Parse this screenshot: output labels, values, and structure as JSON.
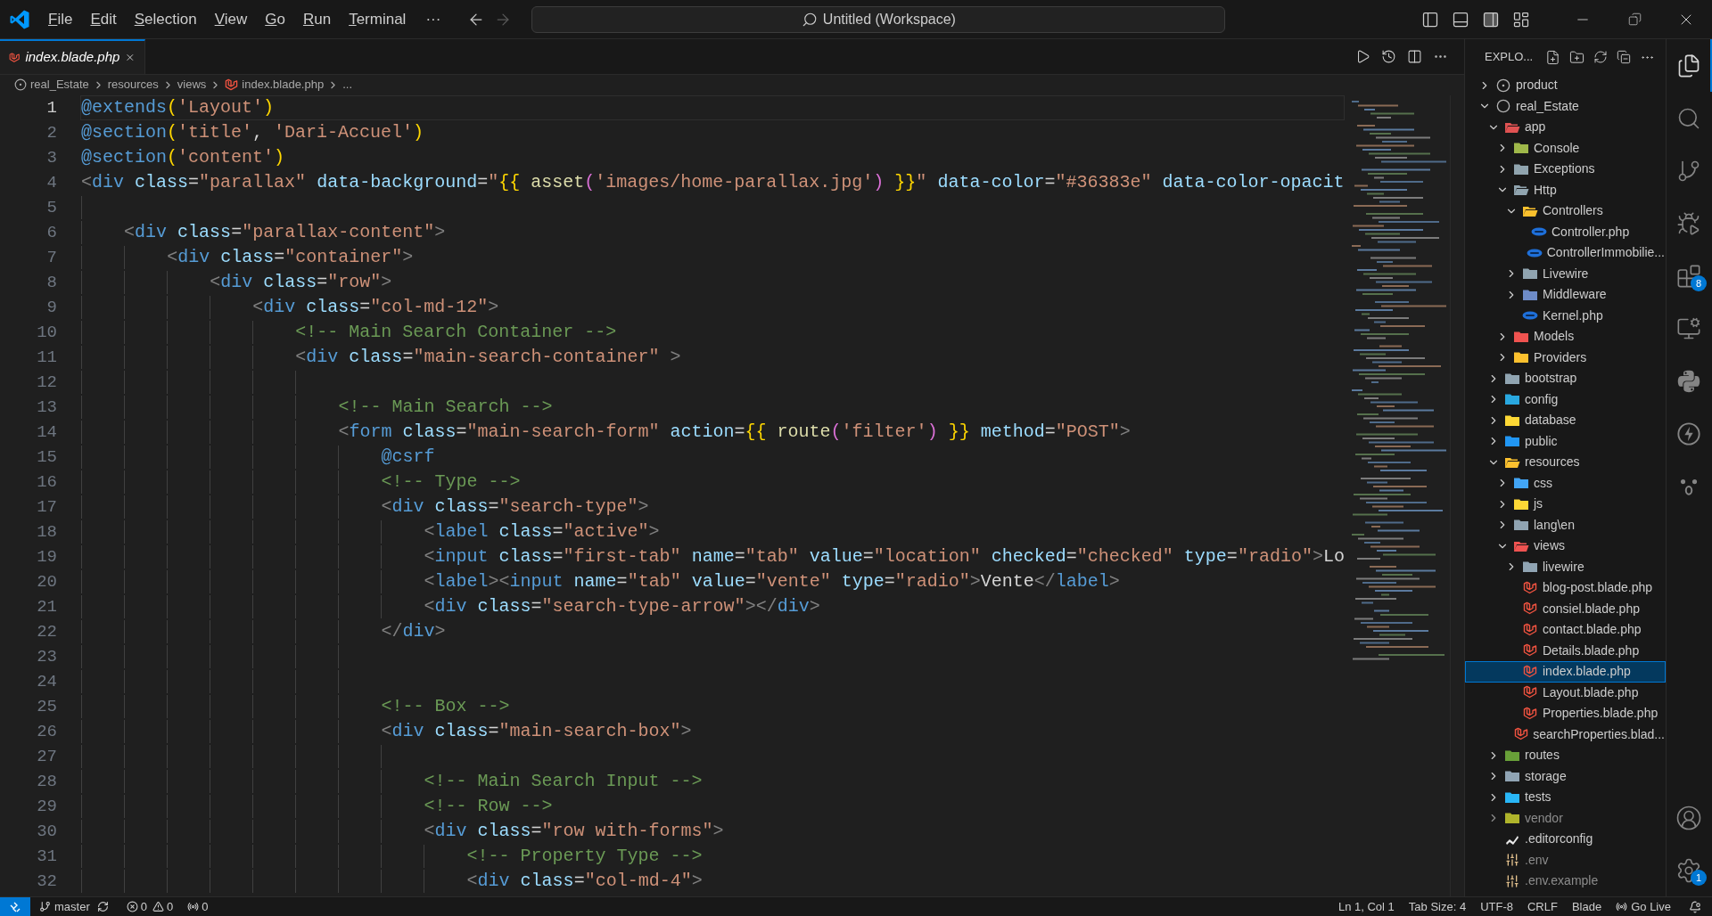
{
  "title_bar": {
    "menu": [
      "File",
      "Edit",
      "Selection",
      "View",
      "Go",
      "Run",
      "Terminal"
    ],
    "more": "···",
    "nav": [
      {
        "kind": "back",
        "disabled": false
      },
      {
        "kind": "forward",
        "disabled": true
      }
    ],
    "search": "Untitled (Workspace)"
  },
  "tabs": [
    {
      "label": "index.blade.php",
      "preview": true,
      "selected": true
    }
  ],
  "breadcrumb": [
    {
      "label": "real_Estate",
      "kind": "root"
    },
    {
      "label": "resources",
      "kind": "folder"
    },
    {
      "label": "views",
      "kind": "folder"
    },
    {
      "label": "index.blade.php",
      "kind": "blade"
    },
    {
      "label": "...",
      "kind": "more"
    }
  ],
  "editor": {
    "lines": [
      {
        "n": "1",
        "text": "@extends('Layout')",
        "current": true
      },
      {
        "n": "2",
        "text": "@section('title', 'Dari-Accuel')",
        "current": false
      },
      {
        "n": "3",
        "text": "@section('content')",
        "current": false
      },
      {
        "n": "4",
        "text": "<div class=\"parallax\" data-background=\"{{ asset('images/home-parallax.jpg') }}\" data-color=\"#36383e\" data-color-opacit",
        "current": false
      },
      {
        "n": "5",
        "current": false
      },
      {
        "n": "6",
        "text": "    <div class=\"parallax-content\">",
        "current": false
      },
      {
        "n": "7",
        "text": "        <div class=\"container\">",
        "current": false
      },
      {
        "n": "8",
        "text": "            <div class=\"row\">",
        "current": false
      },
      {
        "n": "9",
        "text": "                <div class=\"col-md-12\">",
        "current": false
      },
      {
        "n": "10",
        "text": "                    <!-- Main Search Container -->",
        "current": false
      },
      {
        "n": "11",
        "text": "                    <div class=\"main-search-container\" >",
        "current": false
      },
      {
        "n": "12",
        "current": false
      },
      {
        "n": "13",
        "text": "                        <!-- Main Search -->",
        "current": false
      },
      {
        "n": "14",
        "text": "                        <form class=\"main-search-form\" action={{ route('filter') }} method=\"POST\">",
        "current": false
      },
      {
        "n": "15",
        "text": "                            @csrf",
        "current": false
      },
      {
        "n": "16",
        "text": "                            <!-- Type -->",
        "current": false
      },
      {
        "n": "17",
        "text": "                            <div class=\"search-type\">",
        "current": false
      },
      {
        "n": "18",
        "text": "                                <label class=\"active\">",
        "current": false
      },
      {
        "n": "19",
        "text": "                                <input class=\"first-tab\" name=\"tab\" value=\"location\" checked=\"checked\" type=\"radio\">Lo",
        "current": false
      },
      {
        "n": "20",
        "text": "                                <label><input name=\"tab\" value=\"vente\" type=\"radio\">Vente</label>",
        "current": false
      },
      {
        "n": "21",
        "text": "                                <div class=\"search-type-arrow\"></div>",
        "current": false
      },
      {
        "n": "22",
        "text": "                            </div>",
        "current": false
      },
      {
        "n": "23",
        "current": false
      },
      {
        "n": "24",
        "current": false
      },
      {
        "n": "25",
        "text": "                            <!-- Box -->",
        "current": false
      },
      {
        "n": "26",
        "text": "                            <div class=\"main-search-box\">",
        "current": false
      },
      {
        "n": "27",
        "current": false
      },
      {
        "n": "28",
        "text": "                                <!-- Main Search Input -->",
        "current": false
      },
      {
        "n": "29",
        "text": "                                <!-- Row -->",
        "current": false
      },
      {
        "n": "30",
        "text": "                                <div class=\"row with-forms\">",
        "current": false
      },
      {
        "n": "31",
        "text": "                                    <!-- Property Type -->",
        "current": false
      },
      {
        "n": "32",
        "text": "                                    <div class=\"col-md-4\">",
        "current": false
      }
    ]
  },
  "explorer": {
    "title": "EXPLO...",
    "tree": [
      {
        "label": "product",
        "kind": "root-filled",
        "expanded": false,
        "selected": false,
        "dimmed": false
      },
      {
        "label": "real_Estate",
        "kind": "root",
        "expanded": true,
        "selected": false,
        "dimmed": false,
        "children": [
          {
            "label": "app",
            "kind": "folder",
            "color": "#e05252",
            "expanded": true,
            "selected": false,
            "dimmed": false,
            "children": [
              {
                "label": "Console",
                "kind": "folder",
                "color": "#9fb84a",
                "expanded": false,
                "selected": false,
                "dimmed": false
              },
              {
                "label": "Exceptions",
                "kind": "folder",
                "color": "#90a4ae",
                "expanded": false,
                "selected": false,
                "dimmed": false
              },
              {
                "label": "Http",
                "kind": "folder",
                "color": "#90a4af",
                "expanded": true,
                "selected": false,
                "dimmed": false,
                "children": [
                  {
                    "label": "Controllers",
                    "kind": "folder",
                    "color": "#fbc02d",
                    "expanded": true,
                    "selected": false,
                    "dimmed": false,
                    "children": [
                      {
                        "label": "Controller.php",
                        "kind": "php",
                        "selected": false,
                        "dimmed": false
                      },
                      {
                        "label": "ControllerImmobilie...",
                        "kind": "php",
                        "selected": false,
                        "dimmed": false
                      }
                    ]
                  },
                  {
                    "label": "Livewire",
                    "kind": "folder",
                    "color": "#90a4b0",
                    "expanded": false,
                    "selected": false,
                    "dimmed": false
                  },
                  {
                    "label": "Middleware",
                    "kind": "folder",
                    "color": "#6d8bc7",
                    "expanded": false,
                    "selected": false,
                    "dimmed": false
                  },
                  {
                    "label": "Kernel.php",
                    "kind": "php",
                    "selected": false,
                    "dimmed": false
                  }
                ]
              },
              {
                "label": "Models",
                "kind": "folder",
                "color": "#ef5350",
                "expanded": false,
                "selected": false,
                "dimmed": false
              },
              {
                "label": "Providers",
                "kind": "folder",
                "color": "#fbc02e",
                "expanded": false,
                "selected": false,
                "dimmed": false
              }
            ]
          },
          {
            "label": "bootstrap",
            "kind": "folder",
            "color": "#90a4b1",
            "expanded": false,
            "selected": false,
            "dimmed": false
          },
          {
            "label": "config",
            "kind": "folder",
            "color": "#29a8e0",
            "expanded": false,
            "selected": false,
            "dimmed": false
          },
          {
            "label": "database",
            "kind": "folder",
            "color": "#fdd835",
            "expanded": false,
            "selected": false,
            "dimmed": false
          },
          {
            "label": "public",
            "kind": "folder",
            "color": "#2196f3",
            "expanded": false,
            "selected": false,
            "dimmed": false
          },
          {
            "label": "resources",
            "kind": "folder",
            "color": "#fbc02f",
            "expanded": true,
            "selected": false,
            "dimmed": false,
            "children": [
              {
                "label": "css",
                "kind": "folder",
                "color": "#42a5f5",
                "expanded": false,
                "selected": false,
                "dimmed": false
              },
              {
                "label": "js",
                "kind": "folder",
                "color": "#fdd836",
                "expanded": false,
                "selected": false,
                "dimmed": false
              },
              {
                "label": "lang\\en",
                "kind": "folder",
                "color": "#90a4b2",
                "expanded": false,
                "selected": false,
                "dimmed": false
              },
              {
                "label": "views",
                "kind": "folder",
                "color": "#ef5351",
                "expanded": true,
                "selected": false,
                "dimmed": false,
                "children": [
                  {
                    "label": "livewire",
                    "kind": "folder",
                    "color": "#90a4b3",
                    "expanded": false,
                    "selected": false,
                    "dimmed": false
                  },
                  {
                    "label": "blog-post.blade.php",
                    "kind": "blade",
                    "selected": false,
                    "dimmed": false
                  },
                  {
                    "label": "consiel.blade.php",
                    "kind": "blade",
                    "selected": false,
                    "dimmed": false
                  },
                  {
                    "label": "contact.blade.php",
                    "kind": "blade",
                    "selected": false,
                    "dimmed": false
                  },
                  {
                    "label": "Details.blade.php",
                    "kind": "blade",
                    "selected": false,
                    "dimmed": false
                  },
                  {
                    "label": "index.blade.php",
                    "kind": "blade",
                    "selected": true,
                    "dimmed": false
                  },
                  {
                    "label": "Layout.blade.php",
                    "kind": "blade",
                    "selected": false,
                    "dimmed": false
                  },
                  {
                    "label": "Properties.blade.php",
                    "kind": "blade",
                    "selected": false,
                    "dimmed": false
                  },
                  {
                    "label": "searchProperties.blad...",
                    "kind": "blade",
                    "selected": false,
                    "dimmed": false
                  }
                ]
              }
            ]
          },
          {
            "label": "routes",
            "kind": "folder",
            "color": "#689f38",
            "expanded": false,
            "selected": false,
            "dimmed": false
          },
          {
            "label": "storage",
            "kind": "folder",
            "color": "#90a4b4",
            "expanded": false,
            "selected": false,
            "dimmed": false
          },
          {
            "label": "tests",
            "kind": "folder",
            "color": "#29b6f6",
            "expanded": false,
            "selected": false,
            "dimmed": false
          },
          {
            "label": "vendor",
            "kind": "folder",
            "color": "#afb42b",
            "expanded": false,
            "selected": false,
            "dimmed": true
          },
          {
            "label": ".editorconfig",
            "kind": "editorconfig",
            "selected": false,
            "dimmed": false
          },
          {
            "label": ".env",
            "kind": "env",
            "selected": false,
            "dimmed": true
          },
          {
            "label": ".env.example",
            "kind": "env",
            "selected": false,
            "dimmed": true
          }
        ]
      }
    ]
  },
  "activity_bar": [
    {
      "kind": "explorer",
      "selected": true
    },
    {
      "kind": "search",
      "selected": false
    },
    {
      "kind": "source-control",
      "selected": false
    },
    {
      "kind": "run",
      "selected": false
    },
    {
      "kind": "extensions",
      "selected": false,
      "badge": "8"
    },
    {
      "kind": "remote",
      "selected": false
    },
    {
      "kind": "python",
      "selected": false
    },
    {
      "kind": "lightning",
      "selected": false
    },
    {
      "kind": "face",
      "selected": false
    }
  ],
  "activity_bottom": [
    {
      "kind": "account"
    },
    {
      "kind": "settings",
      "badge": "1"
    }
  ],
  "status_bar": {
    "branch": "master",
    "errors": "0",
    "warnings": "0",
    "ports": "0",
    "right": [
      "Ln 1, Col 1",
      "Tab Size: 4",
      "UTF-8",
      "CRLF",
      "Blade"
    ],
    "go_live": "Go Live"
  }
}
